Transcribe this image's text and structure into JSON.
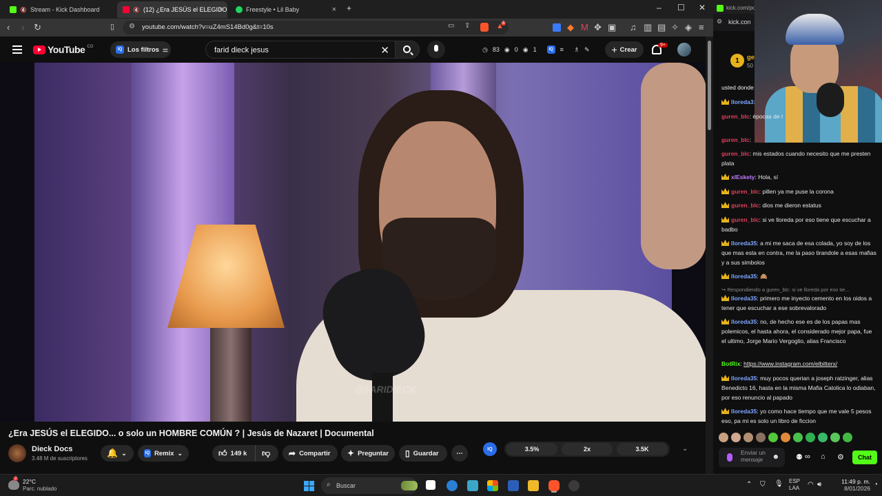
{
  "browser": {
    "tabs": [
      {
        "label": "Stream - Kick Dashboard",
        "active": false
      },
      {
        "label": "(12) ¿Era JESÚS el ELEGIDO...",
        "active": true
      },
      {
        "label": "Freestyle • Lil Baby",
        "active": false
      }
    ],
    "new_tab": "+",
    "url": "youtube.com/watch?v=uZ4mS14Bd0g&t=10s",
    "brave_badge": "8"
  },
  "youtube": {
    "logo_text": "YouTube",
    "logo_country": "CO",
    "filters_label": "Los filtros",
    "search_value": "farid dieck jesus",
    "stats": {
      "views_count": "83",
      "eye_count": "0",
      "ring_count": "1"
    },
    "create_label": "Crear",
    "notif_badge": "9+"
  },
  "video": {
    "watermark": "@FARIDIECK",
    "title": "¿Era JESÚS el ELEGIDO... o solo un HOMBRE COMÚN ? | Jesús de Nazaret | Documental",
    "channel_name": "Dieck Docs",
    "channel_subs": "3.48 M de suscriptores",
    "remix_label": "Remix",
    "likes": "149 k",
    "share_label": "Compartir",
    "ask_label": "Preguntar",
    "save_label": "Guardar",
    "iq_label": "IQ",
    "speed_options": [
      "3.5%",
      "2x",
      "3.5K"
    ]
  },
  "kick": {
    "tab_url": "kick.com/po",
    "url_row": "kick.con",
    "gold_user": "ge",
    "gold_num": "50",
    "gold_badge": "1",
    "first_line": "usted donde",
    "messages": [
      {
        "user": "lloreda3",
        "color": "#7fa7ff",
        "crown": true,
        "text": ""
      },
      {
        "user": "guren_blc",
        "color": "#e0405a",
        "crown": false,
        "text": "épocas de l"
      },
      {
        "user": "guren_blc",
        "color": "#e0405a",
        "crown": false,
        "text": ""
      },
      {
        "user": "guren_blc",
        "color": "#e0405a",
        "crown": false,
        "text": "mis estados cuando necesito que me presten plata"
      },
      {
        "user": "xlEskety",
        "color": "#c27cff",
        "crown": true,
        "text": "Hola, sí"
      },
      {
        "user": "guren_blc",
        "color": "#e0405a",
        "crown": true,
        "text": "pillen ya me puse la corona"
      },
      {
        "user": "guren_blc",
        "color": "#e0405a",
        "crown": true,
        "text": "dios me dieron estatus"
      },
      {
        "user": "guren_blc",
        "color": "#e0405a",
        "crown": true,
        "text": "si ve lloreda por eso tiene que escuchar a badbo"
      },
      {
        "user": "lloreda35",
        "color": "#7fa7ff",
        "crown": true,
        "text": "a mi me saca de esa colada, yo soy de los que mas esta en contra, me la paso tirandole a esas mafias y a sus simbolos"
      },
      {
        "user": "lloreda35",
        "color": "#7fa7ff",
        "crown": true,
        "text": "🙈"
      },
      {
        "user": "lloreda35",
        "color": "#7fa7ff",
        "crown": true,
        "text": "primero me inyecto cemento en los oidos a tener que escuchar a ese sobrevalorado"
      },
      {
        "user": "lloreda35",
        "color": "#7fa7ff",
        "crown": true,
        "text": "no, de hecho ese es de los papas mas polemicos, el hasta ahora, el considerado mejor papa, fue el ultimo, Jorge Mario Vergoglio, alias Francisco"
      },
      {
        "user": "BotRix",
        "color": "#53fc18",
        "crown": false,
        "text": "https://www.instagram.com/elbitterx/"
      },
      {
        "user": "lloreda35",
        "color": "#7fa7ff",
        "crown": true,
        "text": "muy pocos querian a joseph ratzinger, alias Benedicto 16, hasta en la misma Mafia Catolica lo odiaban, por eso renuncio al papado"
      },
      {
        "user": "lloreda35",
        "color": "#7fa7ff",
        "crown": true,
        "text": "yo como hace tiempo que me vale 5 pesos eso, pa mi es solo un libro de ficcion"
      }
    ],
    "reply_hint": "Respondiendo a guren_blc: si ve lloreda por eso tie...",
    "input_placeholder": "Enviar un mensaje",
    "chat_button": "Chat"
  },
  "taskbar": {
    "temp": "22°C",
    "weather": "Parc. nublado",
    "weather_badge": "2",
    "search_placeholder": "Buscar",
    "lang_1": "ESP",
    "lang_2": "LAA",
    "time": "11:49 p. m.",
    "date": "8/01/2026"
  }
}
